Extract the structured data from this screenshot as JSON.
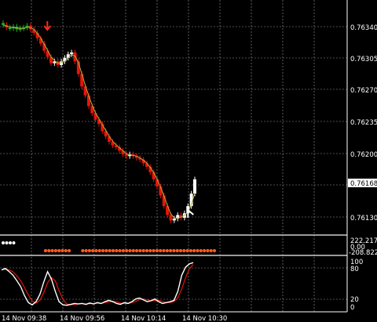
{
  "colors": {
    "background": "#000000",
    "grid": "#9a9a9a",
    "axis": "#ffffff",
    "bear_bar": "#e8140a",
    "bull_bar": "#ffffff",
    "small_bar": "#22aa22",
    "ma_line": "#b0b040",
    "signal_down": "#ff2a1a",
    "dots_white": "#ffffff",
    "dots_orange": "#ff5a1e",
    "osc_main": "#ffffff",
    "osc_signal": "#e8140a",
    "current_price_box": "#ffffff"
  },
  "price_axis": {
    "ticks": [
      "0.76340",
      "0.76305",
      "0.76270",
      "0.76235",
      "0.76200",
      "0.76130"
    ],
    "current_price": "0.76168"
  },
  "time_axis": {
    "ticks": [
      "14 Nov 09:38",
      "14 Nov 09:56",
      "14 Nov 10:14",
      "14 Nov 10:30"
    ]
  },
  "indicator1": {
    "labels": [
      "222.2177",
      "0.00",
      "-208.822"
    ]
  },
  "indicator2": {
    "labels": [
      "100",
      "80",
      "20",
      "0"
    ]
  },
  "chart_data": {
    "type": "candlestick",
    "price_range": [
      0.7611,
      0.7636
    ],
    "candles_close": [
      0.76341,
      0.76338,
      0.76337,
      0.76339,
      0.76336,
      0.76337,
      0.76338,
      0.7634,
      0.76336,
      0.76332,
      0.76326,
      0.7632,
      0.76312,
      0.76305,
      0.76298,
      0.763,
      0.76296,
      0.763,
      0.76304,
      0.76308,
      0.7631,
      0.763,
      0.76286,
      0.76272,
      0.76262,
      0.7625,
      0.76242,
      0.76235,
      0.7623,
      0.76222,
      0.76216,
      0.7621,
      0.76206,
      0.76204,
      0.762,
      0.76196,
      0.76194,
      0.76196,
      0.76194,
      0.76192,
      0.7619,
      0.76186,
      0.76182,
      0.76176,
      0.76168,
      0.7616,
      0.7615,
      0.76138,
      0.76128,
      0.76122,
      0.76124,
      0.76128,
      0.76125,
      0.7613,
      0.76138,
      0.76152,
      0.76168
    ],
    "signal_arrow_candle": 12,
    "white_dots": 4,
    "orange_dots_range": [
      14,
      50
    ],
    "oscillator": [
      82,
      85,
      78,
      70,
      58,
      45,
      25,
      10,
      5,
      12,
      28,
      55,
      78,
      62,
      35,
      12,
      5,
      4,
      6,
      8,
      7,
      8,
      6,
      9,
      7,
      10,
      8,
      12,
      15,
      12,
      8,
      6,
      10,
      8,
      12,
      18,
      20,
      16,
      12,
      14,
      18,
      12,
      8,
      10,
      12,
      15,
      35,
      70,
      88,
      95,
      98
    ]
  }
}
